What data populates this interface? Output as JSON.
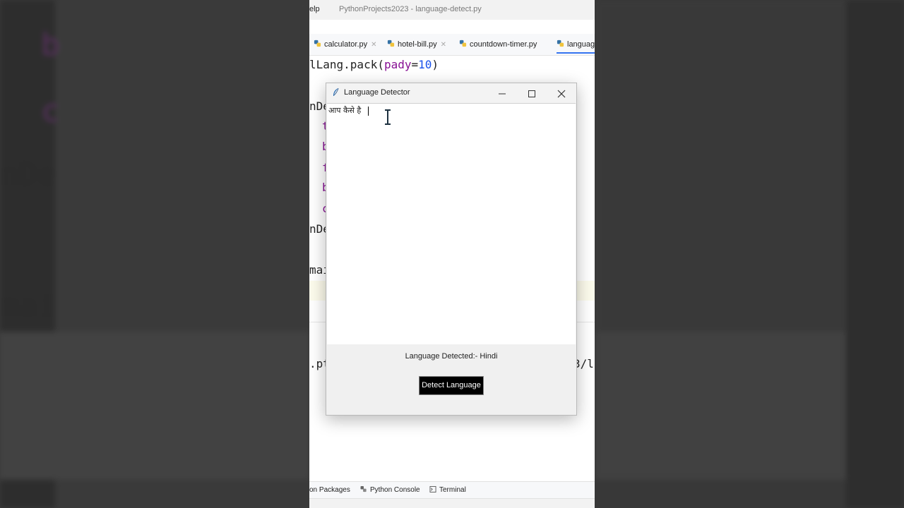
{
  "ide": {
    "menu_label": "Help",
    "menu_visible": "elp",
    "window_title": "PythonProjects2023 - language-detect.py",
    "tabs": [
      {
        "label": "calculator.py"
      },
      {
        "label": "hotel-bill.py"
      },
      {
        "label": "countdown-timer.py"
      },
      {
        "label": "languag"
      }
    ],
    "code_lines": {
      "l1_a": "lLang.pack(",
      "l1_kw": "pady",
      "l1_b": "=",
      "l1_num": "10",
      "l1_c": ")",
      "l2": "nDe",
      "l3": "t",
      "l4": "b",
      "l5": "f",
      "l6": "b",
      "l7": "c",
      "l8": "nDe",
      "l9": "mai",
      "run_left": ".pt",
      "run_right": "3/l"
    },
    "tool_windows": [
      {
        "label": "on Packages"
      },
      {
        "label": "Python Console"
      },
      {
        "label": "Terminal"
      }
    ]
  },
  "side_left": {
    "text_1": "b",
    "text_2": "c",
    "text_3": "nDe",
    "text_4": "mai"
  },
  "tk_window": {
    "title": "Language Detector",
    "input_text": "आप कैसे है",
    "result_label": "Language Detected:- Hindi",
    "button_label": "Detect Language"
  },
  "colors": {
    "accent": "#3574f0",
    "keyword": "#871094",
    "number": "#1750eb",
    "button_bg": "#000000"
  }
}
